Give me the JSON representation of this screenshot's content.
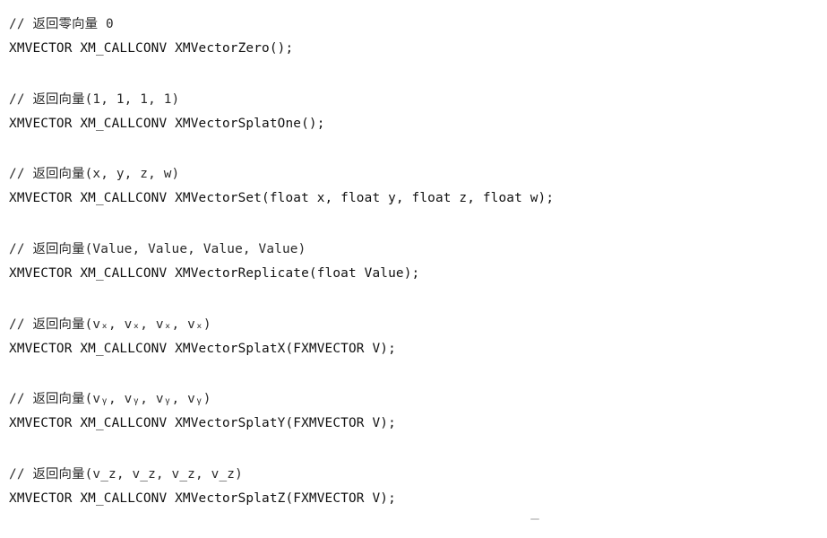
{
  "entries": [
    {
      "comment": "// 返回零向量 0",
      "declaration": "XMVECTOR XM_CALLCONV XMVectorZero();"
    },
    {
      "comment": "// 返回向量(1, 1, 1, 1)",
      "declaration": "XMVECTOR XM_CALLCONV XMVectorSplatOne();"
    },
    {
      "comment": "// 返回向量(x, y, z, w)",
      "declaration": "XMVECTOR XM_CALLCONV XMVectorSet(float x, float y, float z, float w);"
    },
    {
      "comment": "// 返回向量(Value, Value, Value, Value)",
      "declaration": "XMVECTOR XM_CALLCONV XMVectorReplicate(float Value);"
    },
    {
      "comment": "// 返回向量(vₓ, vₓ, vₓ, vₓ)",
      "declaration": "XMVECTOR XM_CALLCONV XMVectorSplatX(FXMVECTOR V);"
    },
    {
      "comment": "// 返回向量(vᵧ, vᵧ, vᵧ, vᵧ)",
      "declaration": "XMVECTOR XM_CALLCONV XMVectorSplatY(FXMVECTOR V);"
    },
    {
      "comment": "// 返回向量(v_z, v_z, v_z, v_z)",
      "declaration": "XMVECTOR XM_CALLCONV XMVectorSplatZ(FXMVECTOR V);"
    }
  ]
}
